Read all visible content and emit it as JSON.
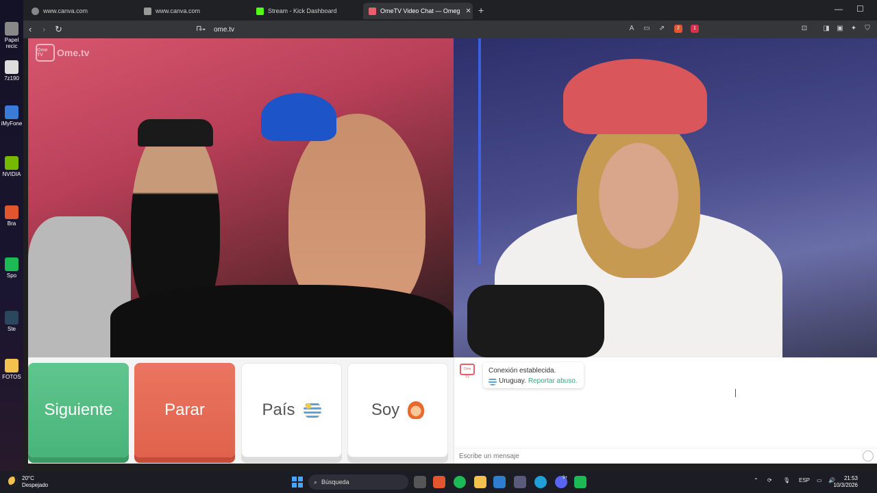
{
  "desktop": {
    "icons": [
      "Papel recic",
      "7z190",
      "iMyFone",
      "NVIDIA",
      "Bra",
      "Spo",
      "Ste",
      "FOTOS"
    ]
  },
  "browser": {
    "tabs": [
      {
        "label": "www.canva.com",
        "active": false
      },
      {
        "label": "www.canva.com",
        "active": false
      },
      {
        "label": "Stream - Kick Dashboard",
        "active": false
      },
      {
        "label": "OmeTV Video Chat — Omeg",
        "active": true
      }
    ],
    "new_tab": "+",
    "url": "ome.tv",
    "brave_badge": "2",
    "rewards_badge": "1"
  },
  "page": {
    "logo_text": "Ome.tv",
    "logo_badge": "Ome TV",
    "buttons": {
      "next": "Siguiente",
      "stop": "Parar",
      "country": "País",
      "gender": "Soy"
    },
    "chat": {
      "system_logo": "Ome TV",
      "connection_text": "Conexión establecida.",
      "country": "Uruguay.",
      "report": "Reportar abuso.",
      "input_placeholder": "Escribe un mensaje"
    },
    "colors": {
      "next": "#4fb981",
      "stop": "#e4684f",
      "link": "#3ba57a"
    }
  },
  "taskbar": {
    "weather_temp": "20°C",
    "weather_desc": "Despejado",
    "search_placeholder": "Búsqueda",
    "language": "ESP",
    "time": "21:53",
    "date": "10/3/2026",
    "discord_badge": "9+"
  }
}
